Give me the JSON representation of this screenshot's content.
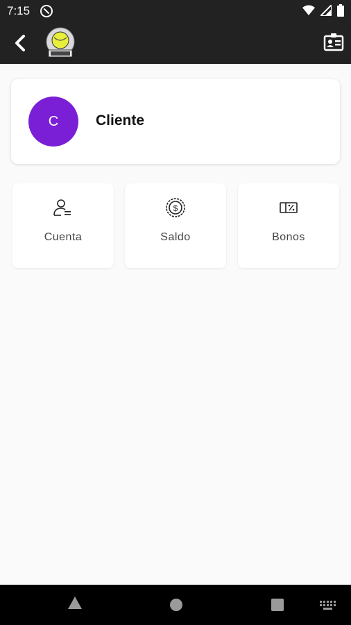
{
  "status_bar": {
    "time": "7:15"
  },
  "profile": {
    "initial": "C",
    "name": "Cliente",
    "avatar_color": "#7a1fd6"
  },
  "tiles": [
    {
      "label": "Cuenta",
      "icon": "user-list-icon"
    },
    {
      "label": "Saldo",
      "icon": "coin-dollar-icon"
    },
    {
      "label": "Bonos",
      "icon": "ticket-percent-icon"
    }
  ],
  "colors": {
    "bars": "#222222",
    "background": "#fafafa"
  }
}
